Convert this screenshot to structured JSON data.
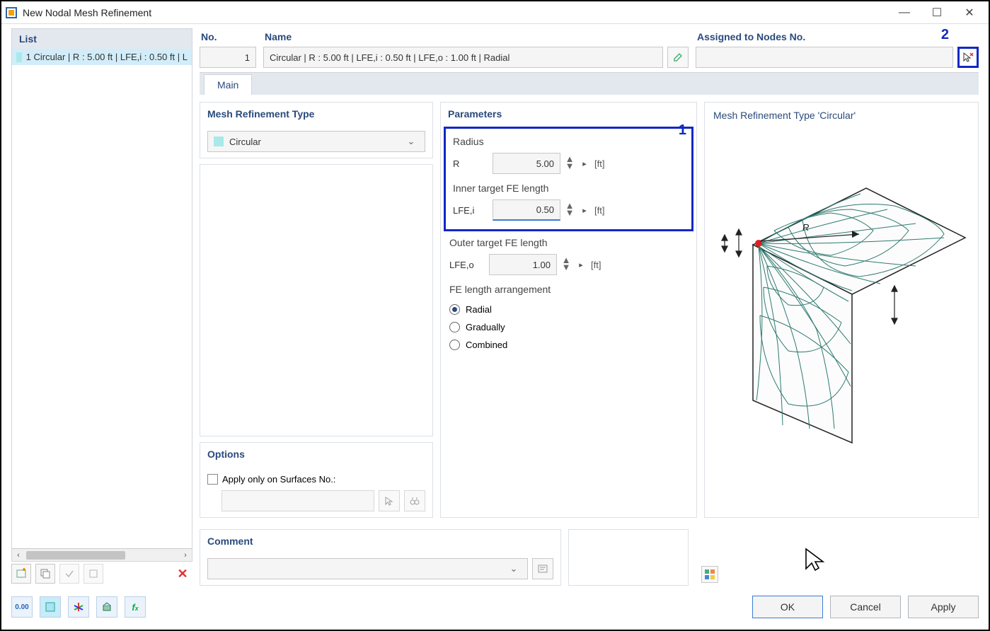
{
  "window": {
    "title": "New Nodal Mesh Refinement"
  },
  "list": {
    "header": "List",
    "item_text": "1 Circular | R : 5.00 ft | LFE,i : 0.50 ft | L"
  },
  "fields": {
    "no_label": "No.",
    "no_value": "1",
    "name_label": "Name",
    "name_value": "Circular | R : 5.00 ft | LFE,i : 0.50 ft | LFE,o : 1.00 ft | Radial",
    "assigned_label": "Assigned to Nodes No."
  },
  "annotations": {
    "num1": "1",
    "num2": "2"
  },
  "tabs": {
    "main": "Main"
  },
  "type": {
    "header": "Mesh Refinement Type",
    "value": "Circular"
  },
  "options": {
    "header": "Options",
    "apply_only": "Apply only on Surfaces No.:"
  },
  "params": {
    "header": "Parameters",
    "radius_label": "Radius",
    "radius_sym": "R",
    "radius_value": "5.00",
    "radius_unit": "[ft]",
    "inner_label": "Inner target FE length",
    "inner_sym": "LFE,i",
    "inner_value": "0.50",
    "inner_unit": "[ft]",
    "outer_label": "Outer target FE length",
    "outer_sym": "LFE,o",
    "outer_value": "1.00",
    "outer_unit": "[ft]",
    "arrangement_label": "FE length arrangement",
    "opt_radial": "Radial",
    "opt_gradually": "Gradually",
    "opt_combined": "Combined"
  },
  "preview": {
    "header": "Mesh Refinement Type 'Circular'"
  },
  "comment": {
    "header": "Comment"
  },
  "buttons": {
    "ok": "OK",
    "cancel": "Cancel",
    "apply": "Apply"
  },
  "status_icons": {
    "units": "0.00"
  }
}
